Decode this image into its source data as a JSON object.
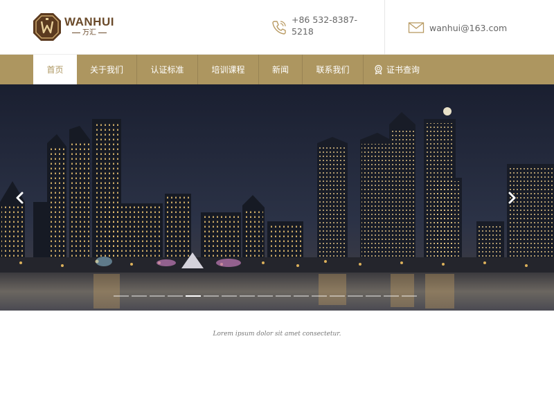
{
  "header": {
    "logo_en": "WANHUI",
    "logo_cn": "万汇",
    "phone": "+86 532-8387-5218",
    "email": "wanhui@163.com"
  },
  "nav": {
    "items": [
      {
        "label": "首页",
        "active": true
      },
      {
        "label": "关于我们"
      },
      {
        "label": "认证标准"
      },
      {
        "label": "培训课程"
      },
      {
        "label": "新闻"
      },
      {
        "label": "联系我们"
      },
      {
        "label": "证书查询",
        "icon": "certificate-icon"
      }
    ]
  },
  "banner": {
    "slide_count": 17,
    "active_index": 4,
    "icons": {
      "prev": "chevron-left-icon",
      "next": "chevron-right-icon"
    }
  },
  "caption": "Lorem ipsum dolor sit amet consectetur.",
  "colors": {
    "accent": "#ad9660",
    "logo_brown": "#6a4a2a",
    "night_sky": "#1e2433"
  }
}
